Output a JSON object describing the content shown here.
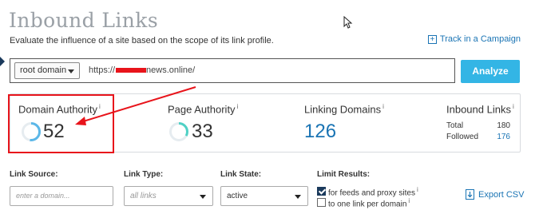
{
  "header": {
    "title": "Inbound Links",
    "subtitle": "Evaluate the influence of a site based on the scope of its link profile.",
    "track_label": "Track in a Campaign",
    "track_icon": "plus-box-icon"
  },
  "search": {
    "scope_label": "root domain",
    "url_prefix": "https://",
    "url_suffix": "news.online/",
    "analyze_label": "Analyze"
  },
  "metrics": {
    "domain_authority": {
      "label": "Domain Authority",
      "value": "52",
      "gauge_fraction": 0.52
    },
    "page_authority": {
      "label": "Page Authority",
      "value": "33",
      "gauge_fraction": 0.33
    },
    "linking_domains": {
      "label": "Linking Domains",
      "value": "126"
    },
    "inbound_links": {
      "label": "Inbound Links",
      "total_label": "Total",
      "total_value": "180",
      "followed_label": "Followed",
      "followed_value": "176"
    },
    "info_marker": "i"
  },
  "filters": {
    "link_source": {
      "label": "Link Source:",
      "placeholder": "enter a domain..."
    },
    "link_type": {
      "label": "Link Type:",
      "value": "all links"
    },
    "link_state": {
      "label": "Link State:",
      "value": "active"
    },
    "limit_results": {
      "label": "Limit Results:",
      "options": [
        {
          "label": "for feeds and proxy sites",
          "checked": true
        },
        {
          "label": "to one link per domain",
          "checked": false
        }
      ]
    },
    "export_label": "Export CSV",
    "export_icon": "download-icon"
  },
  "colors": {
    "accent": "#33b5e5",
    "link": "#1a74b4",
    "annotation": "#e8141b",
    "gauge": "#5bb7e8",
    "gauge_alt": "#4fd1c5"
  }
}
